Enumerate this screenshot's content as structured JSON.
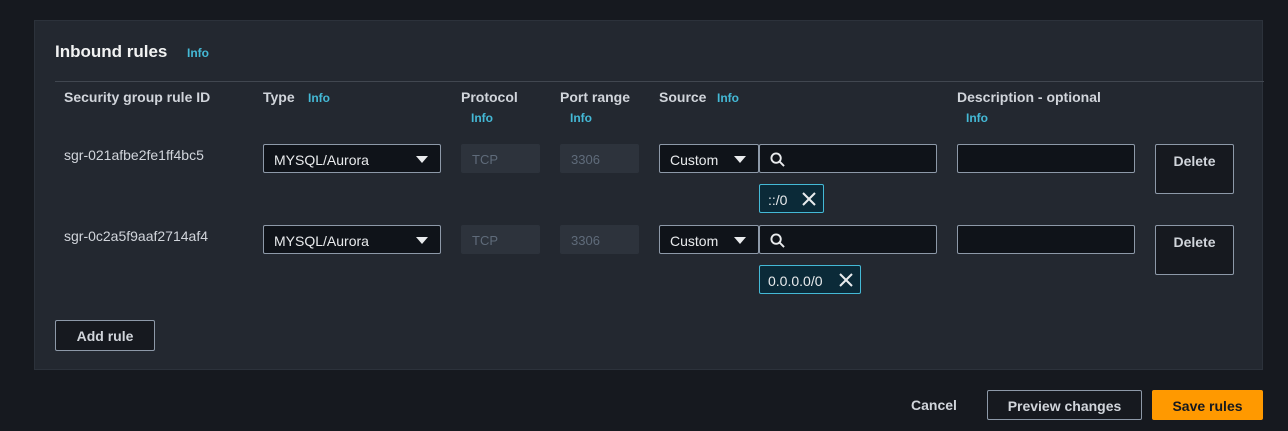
{
  "section": {
    "title": "Inbound rules",
    "info": "Info"
  },
  "columns": {
    "rule_id": "Security group rule ID",
    "type": "Type",
    "type_info": "Info",
    "protocol": "Protocol",
    "protocol_info": "Info",
    "port_range": "Port range",
    "port_range_info": "Info",
    "source": "Source",
    "source_info": "Info",
    "description": "Description - optional",
    "description_info": "Info"
  },
  "rules": [
    {
      "id": "sgr-021afbe2fe1ff4bc5",
      "type": "MYSQL/Aurora",
      "protocol": "TCP",
      "port_range": "3306",
      "source_mode": "Custom",
      "source_token": "::/0",
      "description": "",
      "delete_label": "Delete"
    },
    {
      "id": "sgr-0c2a5f9aaf2714af4",
      "type": "MYSQL/Aurora",
      "protocol": "TCP",
      "port_range": "3306",
      "source_mode": "Custom",
      "source_token": "0.0.0.0/0",
      "description": "",
      "delete_label": "Delete"
    }
  ],
  "actions": {
    "add_rule": "Add rule",
    "cancel": "Cancel",
    "preview": "Preview changes",
    "save": "Save rules"
  },
  "icons": {
    "search": "search-icon",
    "dismiss": "close-icon",
    "dropdown": "caret-down-icon"
  },
  "colors": {
    "background": "#16191f",
    "panel": "#232830",
    "link": "#44b9d6",
    "primary": "#ff9900",
    "token_border": "#44b9d6"
  }
}
